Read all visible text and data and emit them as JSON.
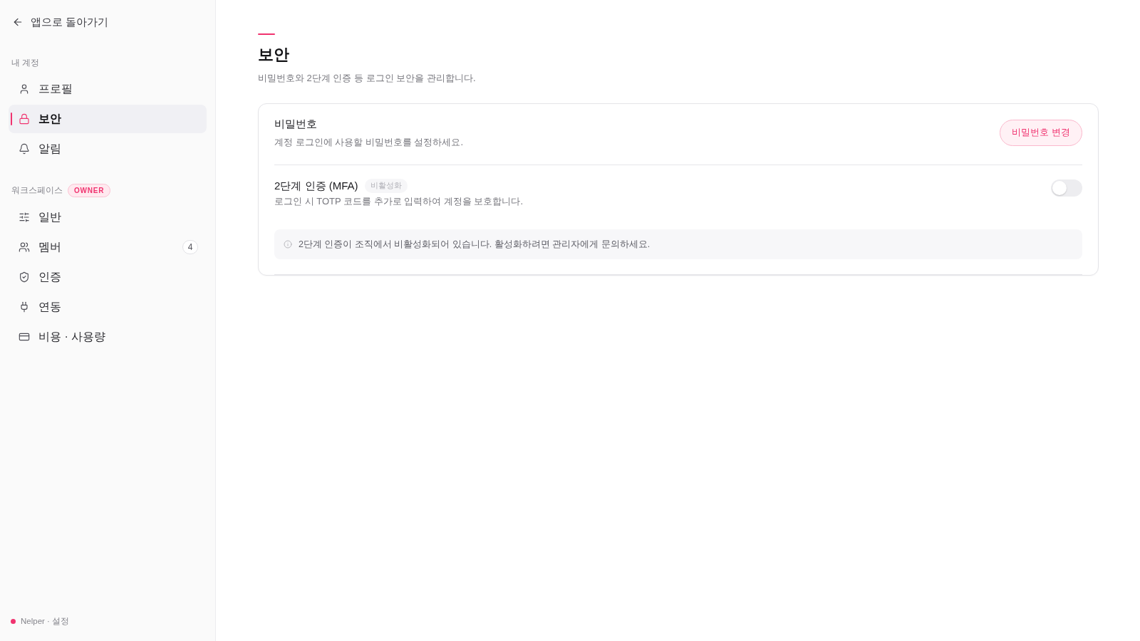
{
  "sidebar": {
    "back_link": "앱으로 돌아가기",
    "sections": [
      {
        "title": "내 계정",
        "items": [
          {
            "kind": "user",
            "label": "프로필",
            "selected": false
          },
          {
            "kind": "lock",
            "label": "보안",
            "selected": true
          },
          {
            "kind": "bell",
            "label": "알림",
            "selected": false
          }
        ]
      },
      {
        "title": "워크스페이스",
        "badge": "OWNER",
        "items": [
          {
            "kind": "sliders",
            "label": "일반",
            "selected": false
          },
          {
            "kind": "users",
            "label": "멤버",
            "count": "4",
            "selected": false
          },
          {
            "kind": "shield",
            "label": "인증",
            "selected": false
          },
          {
            "kind": "plug",
            "label": "연동",
            "selected": false
          },
          {
            "kind": "card",
            "label": "비용 · 사용량",
            "selected": false
          }
        ]
      }
    ],
    "footer": "Nelper · 설정"
  },
  "page": {
    "title": "보안",
    "subtitle": "비밀번호와 2단계 인증 등 로그인 보안을 관리합니다.",
    "card": {
      "rows": [
        {
          "kind": "action",
          "title": "비밀번호",
          "description": "계정 로그인에 사용할 비밀번호를 설정하세요.",
          "button": "비밀번호 변경"
        },
        {
          "kind": "toggle",
          "title": "2단계 인증 (MFA)",
          "badge": "비활성화",
          "description": "로그인 시 TOTP 코드를 추가로 입력하여 계정을 보호합니다.",
          "on": false,
          "notice": "2단계 인증이 조직에서 비활성화되어 있습니다. 활성화하려면 관리자에게 문의하세요."
        }
      ]
    }
  }
}
